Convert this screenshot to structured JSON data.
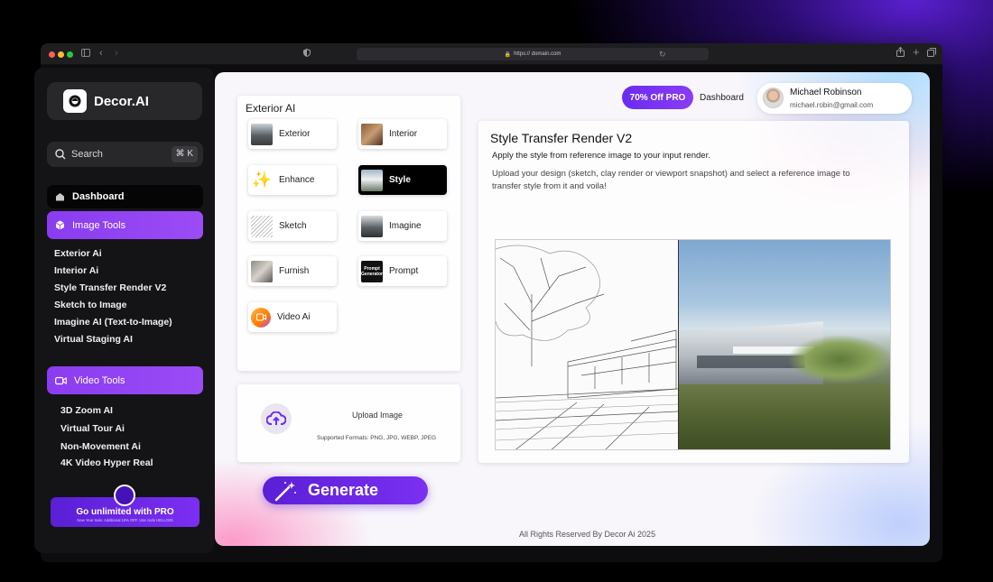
{
  "browser": {
    "url": "https:// domain.com",
    "colors": {
      "close": "#ff5f57",
      "minimize": "#febc2e",
      "maximize": "#28c840"
    }
  },
  "sidebar": {
    "brand": "Decor.AI",
    "search": {
      "placeholder": "Search",
      "shortcut": "⌘ K"
    },
    "dashboard_label": "Dashboard",
    "image_tools": {
      "label": "Image Tools",
      "items": [
        "Exterior Ai",
        "Interior Ai",
        "Style Transfer Render V2",
        "Sketch to Image",
        "Imagine AI (Text-to-Image)",
        "Virtual Staging AI"
      ]
    },
    "video_tools": {
      "label": "Video Tools",
      "items": [
        "3D Zoom AI",
        "Virtual Tour Ai",
        "Non-Movement Ai",
        "4K Video Hyper Real"
      ]
    },
    "promo": {
      "title": "Go unlimited with PRO",
      "subtitle": "New Year Sale: Additional 15% OFF. Use code HELLO25"
    },
    "accent_color": "#8a3cf0"
  },
  "header": {
    "promo_pill": "70% Off PRO",
    "dashboard_link": "Dashboard",
    "user": {
      "name": "Michael Robinson",
      "email": "michael.robin@gmail.com"
    }
  },
  "tools_panel": {
    "title": "Exterior AI",
    "tiles": [
      {
        "label": "Exterior",
        "active": false
      },
      {
        "label": "Interior",
        "active": false
      },
      {
        "label": "Enhance",
        "active": false
      },
      {
        "label": "Style",
        "active": true
      },
      {
        "label": "Sketch",
        "active": false
      },
      {
        "label": "Imagine",
        "active": false
      },
      {
        "label": "Furnish",
        "active": false
      },
      {
        "label": "Prompt",
        "active": false,
        "thumb_text": "Prompt Generator"
      },
      {
        "label": "Video Ai",
        "active": false
      }
    ]
  },
  "upload": {
    "label": "Upload Image",
    "formats": "Supported Formats: PNG, JPG, WEBP, JPEG"
  },
  "generate_button": "Generate",
  "content": {
    "title": "Style Transfer Render V2",
    "subtitle": "Apply the style from reference image to your input render.",
    "description": "Upload your design (sketch, clay render or viewport snapshot) and select a reference image to transfer style from it and voila!"
  },
  "footer": "All Rights Reserved By Decor Ai 2025"
}
